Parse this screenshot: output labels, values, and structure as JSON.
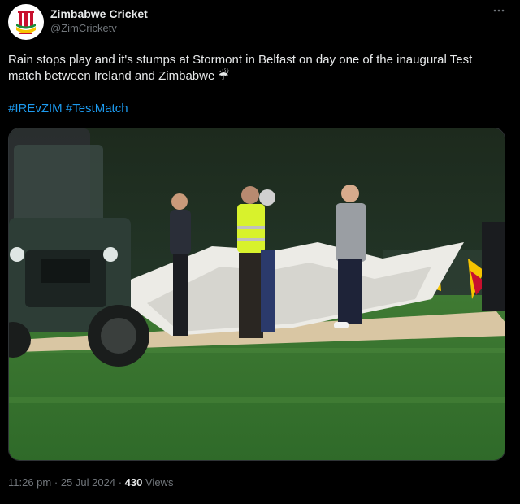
{
  "author": {
    "name": "Zimbabwe Cricket",
    "handle": "@ZimCricketv",
    "avatar_icon": "zimbabwe-cricket-logo"
  },
  "more_icon": "more-options-icon",
  "tweet": {
    "text": "Rain stops play and it's stumps at  Stormont in Belfast on day one of the inaugural Test match between Ireland and Zimbabwe ☔",
    "hashtags": [
      "#IREvZIM",
      "#TestMatch"
    ]
  },
  "media": {
    "description_icon": "photo"
  },
  "meta": {
    "time": "11:26 pm",
    "separator": "·",
    "date": "25 Jul 2024",
    "views_count": "430",
    "views_label": "Views"
  },
  "colors": {
    "background": "#000000",
    "text": "#e7e9ea",
    "secondary": "#71767b",
    "link": "#1d9bf0"
  }
}
